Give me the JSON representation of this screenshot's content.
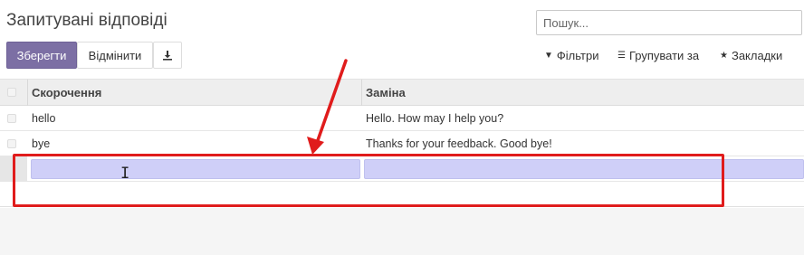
{
  "header": {
    "title": "Запитувані відповіді"
  },
  "search": {
    "placeholder": "Пошук..."
  },
  "toolbar": {
    "save_label": "Зберегти",
    "discard_label": "Відмінити",
    "download_icon": "download-icon"
  },
  "search_options": {
    "filters": "Фільтри",
    "group_by": "Групувати за",
    "favorites": "Закладки"
  },
  "table": {
    "columns": [
      "Скорочення",
      "Заміна"
    ],
    "rows": [
      {
        "shortcut": "hello",
        "substitution": "Hello. How may I help you?"
      },
      {
        "shortcut": "bye",
        "substitution": "Thanks for your feedback. Good bye!"
      }
    ]
  },
  "colors": {
    "primary": "#7c6fa4",
    "editing_row": "#cfcff8",
    "annotation": "#e01c1c"
  }
}
